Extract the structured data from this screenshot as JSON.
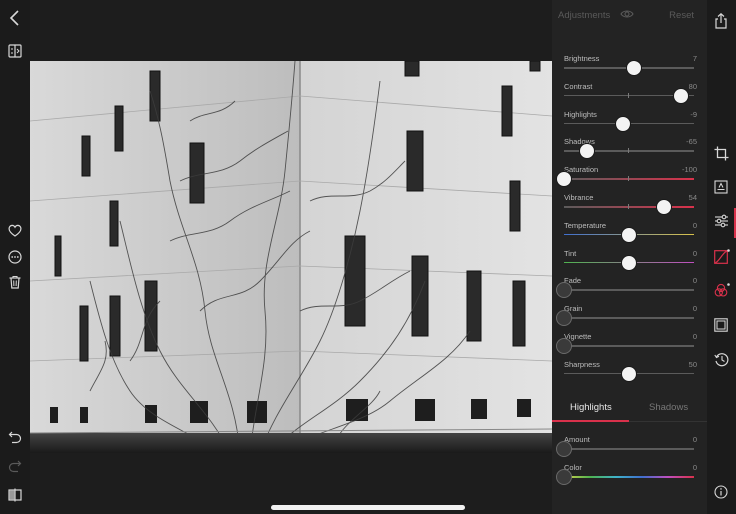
{
  "left_toolbar": {
    "back_icon": "chevron-left",
    "compare_icon": "split-compare",
    "favorite_icon": "heart",
    "more_icon": "ellipsis-circle",
    "delete_icon": "trash",
    "undo_icon": "undo-arrow",
    "redo_icon": "redo-arrow",
    "before_after_icon": "split-view"
  },
  "adjustments": {
    "title": "Adjustments",
    "reset_label": "Reset",
    "sliders": [
      {
        "label": "Brightness",
        "value": "7",
        "level": 7,
        "min": -100,
        "max": 100,
        "track": "neutral"
      },
      {
        "label": "Contrast",
        "value": "80",
        "level": 80,
        "min": -100,
        "max": 100,
        "track": "neutral"
      },
      {
        "label": "Highlights",
        "value": "-9",
        "level": -9,
        "min": -100,
        "max": 100,
        "track": "neutral"
      },
      {
        "label": "Shadows",
        "value": "-65",
        "level": -65,
        "min": -100,
        "max": 100,
        "track": "neutral"
      },
      {
        "label": "Saturation",
        "value": "-100",
        "level": -100,
        "min": -100,
        "max": 100,
        "track": "saturation"
      },
      {
        "label": "Vibrance",
        "value": "54",
        "level": 54,
        "min": -100,
        "max": 100,
        "track": "saturation"
      },
      {
        "label": "Temperature",
        "value": "0",
        "level": 0,
        "min": -100,
        "max": 100,
        "track": "temperature"
      },
      {
        "label": "Tint",
        "value": "0",
        "level": 0,
        "min": -100,
        "max": 100,
        "track": "tint"
      },
      {
        "label": "Fade",
        "value": "0",
        "level": 0,
        "min": 0,
        "max": 100,
        "track": "neutral"
      },
      {
        "label": "Grain",
        "value": "0",
        "level": 0,
        "min": 0,
        "max": 100,
        "track": "neutral"
      },
      {
        "label": "Vignette",
        "value": "0",
        "level": 0,
        "min": 0,
        "max": 100,
        "track": "neutral"
      },
      {
        "label": "Sharpness",
        "value": "50",
        "level": 50,
        "min": 0,
        "max": 100,
        "track": "neutral"
      }
    ]
  },
  "split_toning": {
    "tabs": [
      {
        "label": "Highlights",
        "active": true
      },
      {
        "label": "Shadows",
        "active": false
      }
    ],
    "sliders": [
      {
        "label": "Amount",
        "value": "0",
        "level": 0,
        "min": 0,
        "max": 100,
        "track": "neutral"
      },
      {
        "label": "Color",
        "value": "0",
        "level": 0,
        "min": 0,
        "max": 100,
        "track": "hue"
      }
    ]
  },
  "right_toolbar": {
    "share_icon": "share",
    "crop_icon": "crop",
    "text_icon": "text-frame",
    "adjust_icon": "sliders",
    "curves_icon": "curves",
    "color_icon": "color-mix",
    "frame_icon": "frame",
    "history_icon": "history-clock",
    "info_icon": "info"
  },
  "colors": {
    "accent": "#d9314b",
    "panel_bg": "#232323",
    "track_neutral": "#5b5b5b",
    "temperature_start": "#3f6fcf",
    "temperature_end": "#d9c24a",
    "tint_start": "#4fb34f",
    "tint_end": "#c04fc0",
    "saturation_start": "#5b5b5b",
    "saturation_end": "#d9314b"
  },
  "photo": {
    "subject": "black and white photo of a building corner covered with bare ivy vines"
  }
}
